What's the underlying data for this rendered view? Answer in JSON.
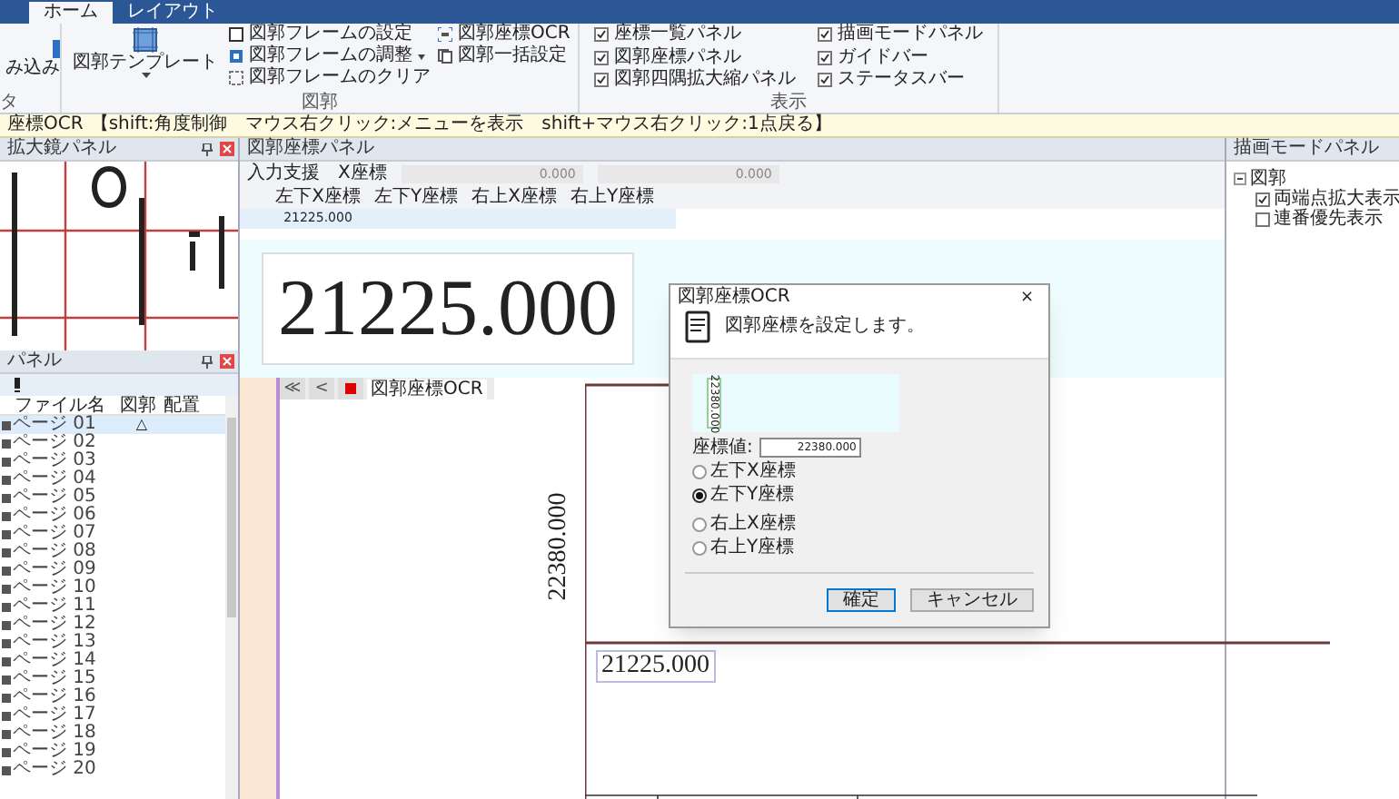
{
  "ribbon": {
    "tabs": [
      {
        "label": "ホーム",
        "selected": true
      },
      {
        "label": "レイアウト",
        "selected": false
      }
    ],
    "partial_group": {
      "button": "み込み",
      "label": "タ"
    },
    "frame_group": {
      "label": "図郭",
      "big_button": "図郭テンプレート",
      "items": [
        {
          "label": "図郭フレームの設定",
          "kind": "frame"
        },
        {
          "label": "図郭フレームの調整",
          "kind": "adjust"
        },
        {
          "label": "図郭フレームのクリア",
          "kind": "clear"
        },
        {
          "label": "図郭座標OCR",
          "kind": "ocr"
        },
        {
          "label": "図郭一括設定",
          "kind": "batch"
        }
      ]
    },
    "view_group": {
      "label": "表示",
      "items": [
        {
          "label": "座標一覧パネル",
          "checked": true
        },
        {
          "label": "図郭座標パネル",
          "checked": true
        },
        {
          "label": "図郭四隅拡大縮パネル",
          "checked": true
        },
        {
          "label": "描画モードパネル",
          "checked": true
        },
        {
          "label": "ガイドバー",
          "checked": true
        },
        {
          "label": "ステータスバー",
          "checked": true
        }
      ]
    }
  },
  "info_bar": {
    "mode": "座標OCR",
    "hint": "【shift:角度制御　マウス右クリック:メニューを表示　shift+マウス右クリック:1点戻る】"
  },
  "magnifier_panel": {
    "title": "拡大鏡パネル"
  },
  "page_panel": {
    "title": "パネル",
    "columns": [
      "ファイル名",
      "図郭",
      "配置"
    ],
    "rows": [
      {
        "name": "ページ 01",
        "frame": "△",
        "selected": true
      },
      {
        "name": "ページ 02",
        "selected": false
      },
      {
        "name": "ページ 03",
        "selected": false
      },
      {
        "name": "ページ 04",
        "selected": false
      },
      {
        "name": "ページ 05",
        "selected": false
      },
      {
        "name": "ページ 06",
        "selected": false
      },
      {
        "name": "ページ 07",
        "selected": false
      },
      {
        "name": "ページ 08",
        "selected": false
      },
      {
        "name": "ページ 09",
        "selected": false
      },
      {
        "name": "ページ 10",
        "selected": false
      },
      {
        "name": "ページ 11",
        "selected": false
      },
      {
        "name": "ページ 12",
        "selected": false
      },
      {
        "name": "ページ 13",
        "selected": false
      },
      {
        "name": "ページ 14",
        "selected": false
      },
      {
        "name": "ページ 15",
        "selected": false
      },
      {
        "name": "ページ 16",
        "selected": false
      },
      {
        "name": "ページ 17",
        "selected": false
      },
      {
        "name": "ページ 18",
        "selected": false
      },
      {
        "name": "ページ 19",
        "selected": false
      },
      {
        "name": "ページ 20",
        "selected": false
      }
    ]
  },
  "coord_panel": {
    "title": "図郭座標パネル",
    "input_label": "入力支援　X座標",
    "inputs": [
      "0.000",
      "0.000"
    ],
    "columns": [
      "左下X座標",
      "左下Y座標",
      "右上X座標",
      "右上Y座標"
    ],
    "rows": [
      {
        "cells": [
          "21225.000"
        ]
      }
    ]
  },
  "canvas": {
    "preview_value": "21225.000",
    "toolbar": {
      "buttons": [
        "≪",
        "<"
      ],
      "label": "図郭座標OCR"
    },
    "vertical_value": "22380.000",
    "horizontal_value": "21225.000"
  },
  "draw_mode_panel": {
    "title": "描画モードパネル",
    "tree": [
      {
        "label": "図郭",
        "expanded": true,
        "children": [
          {
            "label": "両端点拡大表示",
            "checked": true
          },
          {
            "label": "連番優先表示",
            "checked": false
          }
        ]
      }
    ]
  },
  "dialog": {
    "title": "図郭座標OCR",
    "close": "×",
    "message": "図郭座標を設定します。",
    "preview_value": "22380.000",
    "value_label": "座標値:",
    "value": "22380.000",
    "options": [
      {
        "label": "左下X座標",
        "selected": false
      },
      {
        "label": "左下Y座標",
        "selected": true
      },
      {
        "label": "右上X座標",
        "selected": false
      },
      {
        "label": "右上Y座標",
        "selected": false
      }
    ],
    "buttons": [
      "確定",
      "キャンセル"
    ]
  }
}
